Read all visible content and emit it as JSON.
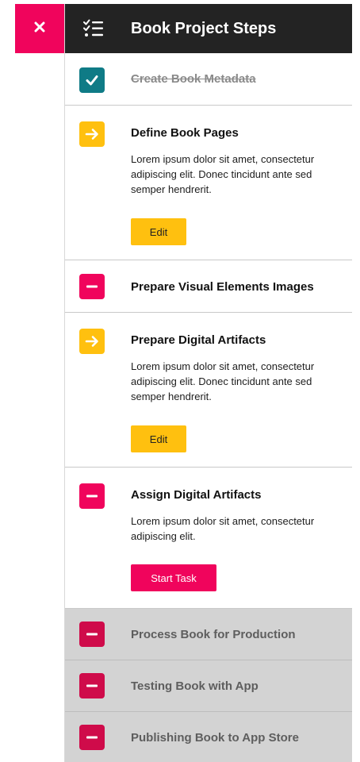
{
  "header": {
    "close_icon": "close-icon",
    "list_icon": "checklist-icon",
    "title": "Book Project Steps"
  },
  "colors": {
    "accent_pink": "#f0045c",
    "done_teal": "#0f7b86",
    "progress_yellow": "#ffc00f",
    "header_dark": "#232323",
    "muted_gray": "#d3d3d3"
  },
  "steps": [
    {
      "status": "done",
      "icon": "checkmark-icon",
      "title": "Create Book Metadata"
    },
    {
      "status": "in-progress",
      "icon": "arrow-right-icon",
      "title": "Define Book Pages",
      "description": "Lorem ipsum dolor sit amet, consectetur adipiscing elit. Donec tincidunt ante sed semper hendrerit.",
      "button_label": "Edit"
    },
    {
      "status": "blocked",
      "icon": "minus-icon",
      "title": "Prepare Visual Elements Images"
    },
    {
      "status": "in-progress",
      "icon": "arrow-right-icon",
      "title": "Prepare Digital Artifacts",
      "description": "Lorem ipsum dolor sit amet, consectetur adipiscing elit. Donec tincidunt ante sed semper hendrerit.",
      "button_label": "Edit"
    },
    {
      "status": "blocked",
      "icon": "minus-icon",
      "title": "Assign Digital Artifacts",
      "description": "Lorem ipsum dolor sit amet, consectetur adipiscing elit.",
      "button_label": "Start Task"
    },
    {
      "status": "blocked-muted",
      "icon": "minus-icon",
      "title": "Process Book for Production"
    },
    {
      "status": "blocked-muted",
      "icon": "minus-icon",
      "title": "Testing Book with App"
    },
    {
      "status": "blocked-muted",
      "icon": "minus-icon",
      "title": "Publishing Book to App Store"
    }
  ]
}
